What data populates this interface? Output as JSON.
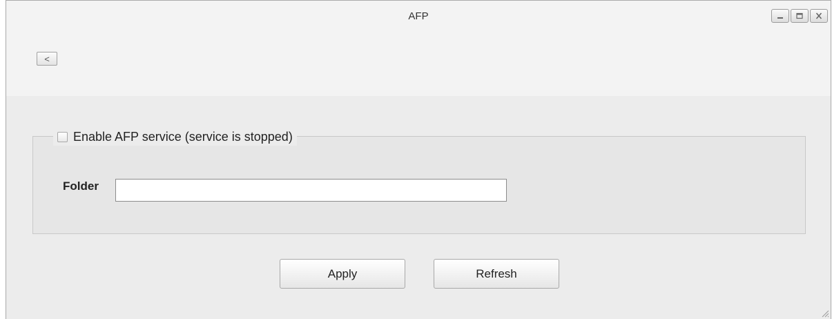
{
  "window": {
    "title": "AFP",
    "controls": [
      {
        "name": "minimize",
        "icon": "minimize-icon"
      },
      {
        "name": "maximize",
        "icon": "maximize-icon"
      },
      {
        "name": "close",
        "icon": "close-icon"
      }
    ]
  },
  "toolbar": {
    "back_label": "<"
  },
  "service": {
    "enable_label": "Enable AFP service (service is stopped)",
    "enabled": false
  },
  "folder": {
    "label": "Folder",
    "value": "",
    "placeholder": ""
  },
  "actions": {
    "apply_label": "Apply",
    "refresh_label": "Refresh"
  }
}
